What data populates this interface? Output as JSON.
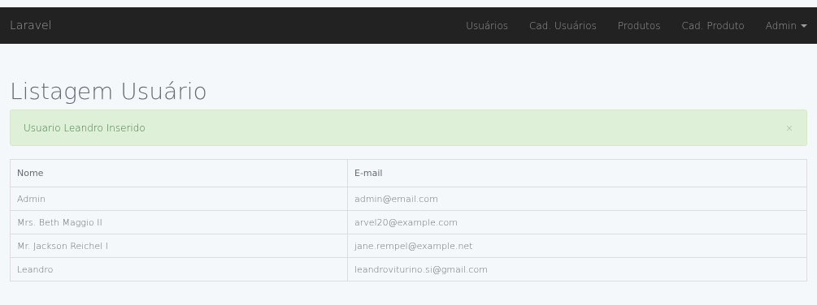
{
  "navbar": {
    "brand": "Laravel",
    "items": [
      "Usuários",
      "Cad. Usuários",
      "Produtos",
      "Cad. Produto"
    ],
    "user_menu": "Admin"
  },
  "page": {
    "title": "Listagem Usuário"
  },
  "alert": {
    "message": "Usuario Leandro Inserido",
    "close": "×"
  },
  "table": {
    "headers": [
      "Nome",
      "E-mail"
    ],
    "rows": [
      [
        "Admin",
        "admin@email.com"
      ],
      [
        "Mrs. Beth Maggio II",
        "arvel20@example.com"
      ],
      [
        "Mr. Jackson Reichel I",
        "jane.rempel@example.net"
      ],
      [
        "Leandro",
        "leandroviturino.si@gmail.com"
      ]
    ]
  }
}
